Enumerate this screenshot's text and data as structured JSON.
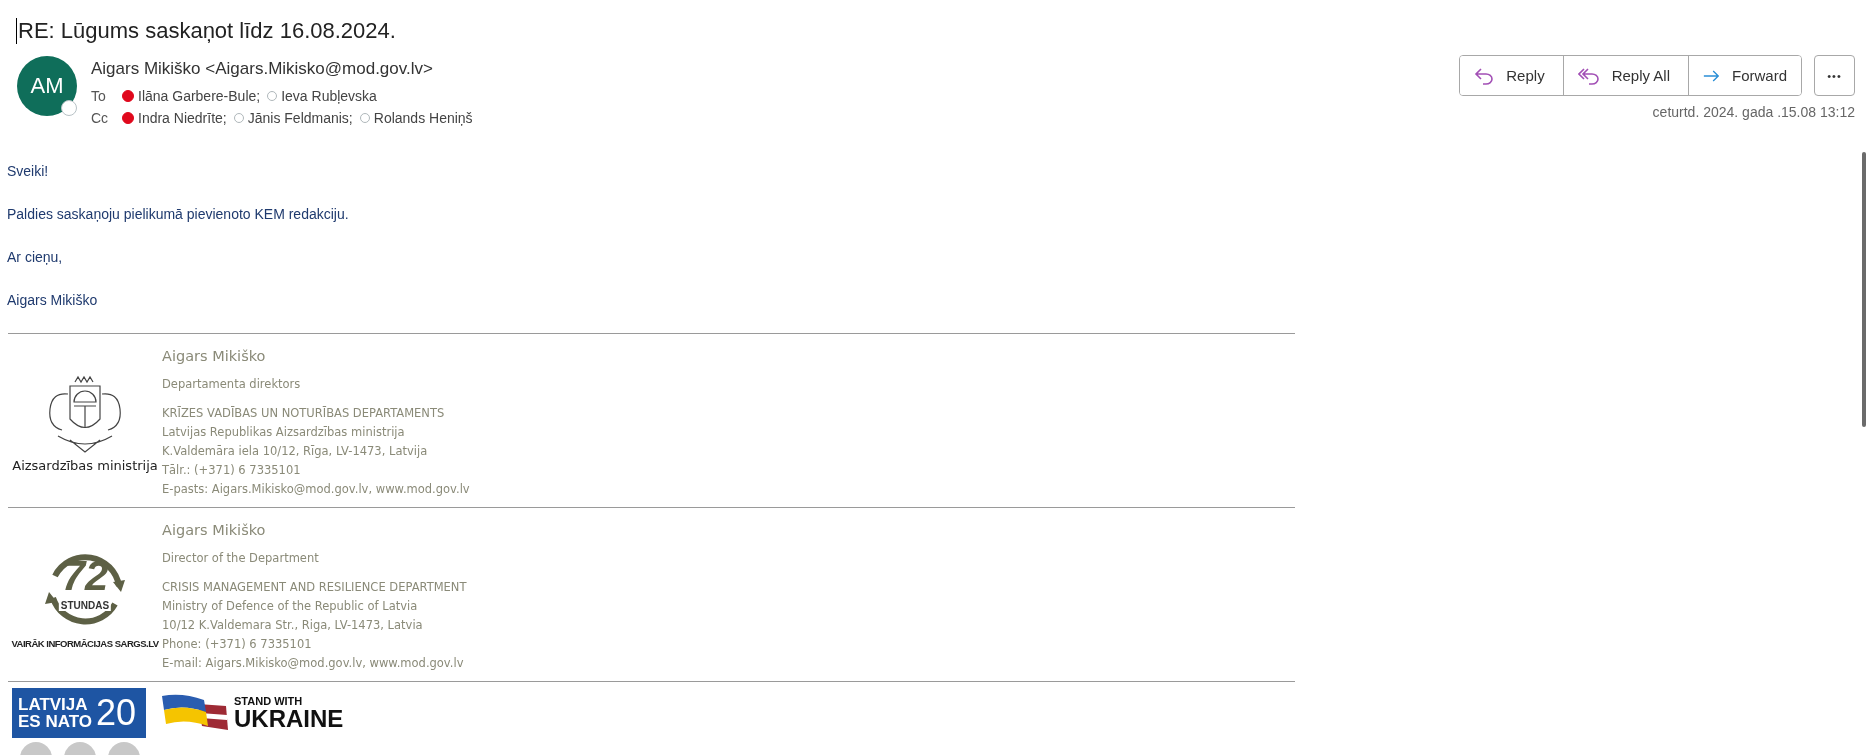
{
  "subject": "RE: Lūgums saskaņot līdz 16.08.2024.",
  "sender": {
    "initials": "AM",
    "name": "Aigars Mikiško <Aigars.Mikisko@mod.gov.lv>"
  },
  "to": {
    "label": "To",
    "recipients": [
      {
        "name": "Ilāna Garbere-Bule;",
        "busy": true
      },
      {
        "name": "Ieva Rubļevska",
        "busy": false
      }
    ]
  },
  "cc": {
    "label": "Cc",
    "recipients": [
      {
        "name": "Indra Niedrīte;",
        "busy": true
      },
      {
        "name": "Jānis Feldmanis;",
        "busy": false
      },
      {
        "name": "Rolands Heniņš",
        "busy": false
      }
    ]
  },
  "actions": [
    {
      "label": "Reply",
      "kind": "reply"
    },
    {
      "label": "Reply All",
      "kind": "replyall"
    },
    {
      "label": "Forward",
      "kind": "forward"
    }
  ],
  "more": "•••",
  "date": "ceturtd. 2024.  gada .15.08 13:12",
  "body": [
    "Sveiki!",
    "Paldies saskaņoju pielikumā pievienoto KEM redakciju.",
    "Ar cieņu,",
    "Aigars Mikiško"
  ],
  "signatures": [
    {
      "kind": "crest",
      "logo_text": [
        "Aizsardzības ministrija"
      ],
      "name": "Aigars Mikiško",
      "title": "Departamenta direktors",
      "lines": [
        "KRĪZES VADĪBAS UN NOTURĪBAS DEPARTAMENTS",
        "Latvijas Republikas Aizsardzības ministrija",
        "K.Valdemāra iela 10/12, Rīga, LV-1473, Latvija",
        "Tālr.: (+371) 6 7335101",
        "E-pasts: Aigars.Mikisko@mod.gov.lv, www.mod.gov.lv"
      ]
    },
    {
      "kind": "clock",
      "logo_text": [
        "72",
        "STUNDAS",
        "VAIRĀK INFORMĀCIJAS SARGS.LV"
      ],
      "name": "Aigars Mikiško",
      "title": "Director of the Department",
      "lines": [
        "CRISIS MANAGEMENT AND RESILIENCE DEPARTMENT",
        "Ministry of Defence of the Republic of Latvia",
        "10/12 K.Valdemara Str., Riga, LV-1473, Latvia",
        "Phone: (+371) 6 7335101",
        "E-mail: Aigars.Mikisko@mod.gov.lv, www.mod.gov.lv"
      ]
    }
  ],
  "banners": {
    "nato": [
      "LATVIJA",
      "ES NATO",
      "20"
    ],
    "ukraine": [
      "STAND WITH",
      "UKRAINE"
    ]
  }
}
